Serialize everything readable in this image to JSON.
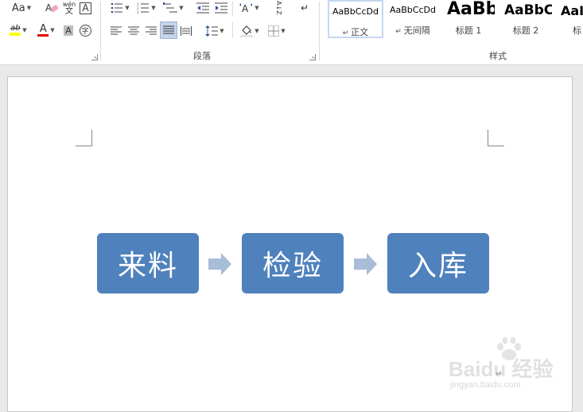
{
  "ribbon": {
    "font_group": {
      "change_case": "Aa",
      "phonetic_top": "wén",
      "phonetic_bottom": "文",
      "char_border": "A",
      "highlight_text": "ab",
      "font_color": "A",
      "char_shading": "A",
      "enclose_char": "字"
    },
    "paragraph_group": {
      "label": "段落",
      "sort": "A↓Z"
    },
    "styles_group": {
      "label": "样式",
      "tiles": [
        {
          "sample": "AaBbCcDd",
          "name": "正文",
          "prefix": "↵"
        },
        {
          "sample": "AaBbCcDd",
          "name": "无间隔",
          "prefix": "↵"
        },
        {
          "sample": "AaBb",
          "name": "标题 1",
          "prefix": ""
        },
        {
          "sample": "AaBbC",
          "name": "标题 2",
          "prefix": ""
        },
        {
          "sample": "AaI",
          "name": "标",
          "prefix": ""
        }
      ]
    }
  },
  "document": {
    "flow_steps": [
      "来料",
      "检验",
      "入库"
    ],
    "paragraph_mark": "↵"
  },
  "watermark": {
    "brand": "Baidu 经验",
    "url": "jingyan.baidu.com"
  },
  "colors": {
    "step_fill": "#4f81bd",
    "arrow_fill": "#a9bcd8",
    "highlight_yellow": "#ffff00",
    "font_red": "#e00000"
  }
}
